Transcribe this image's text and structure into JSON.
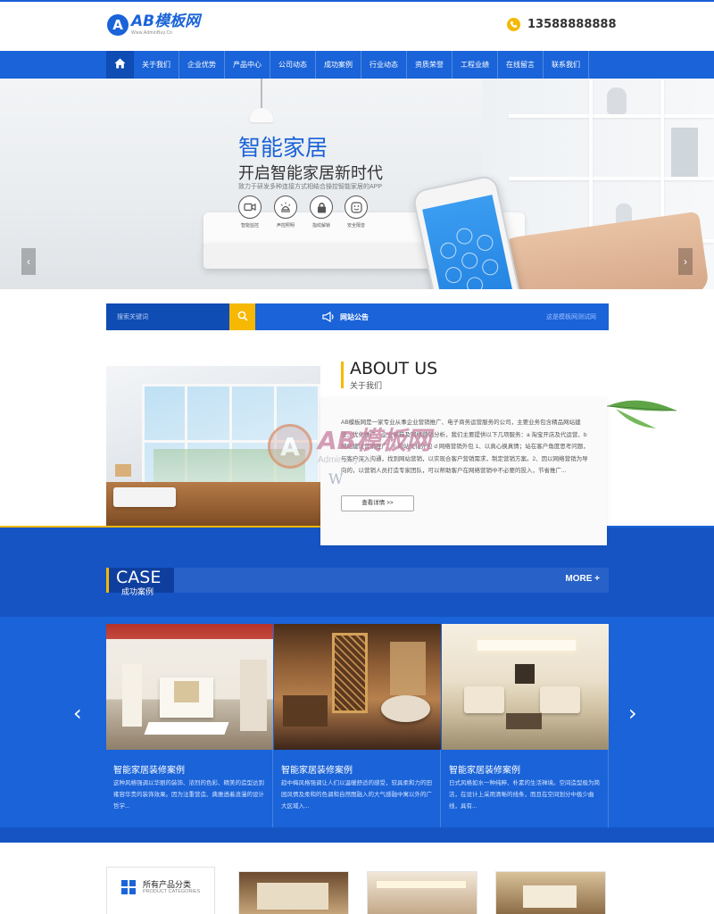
{
  "header": {
    "logo_mark": "A",
    "logo_title": "AB模板网",
    "logo_subtitle": "Www.AdminBuy.Cn",
    "phone_icon": "phone-icon",
    "phone": "13588888888"
  },
  "nav": {
    "home_icon": "home-icon",
    "items": [
      {
        "label": "关于我们"
      },
      {
        "label": "企业优势"
      },
      {
        "label": "产品中心"
      },
      {
        "label": "公司动态"
      },
      {
        "label": "成功案例"
      },
      {
        "label": "行业动态"
      },
      {
        "label": "资质荣誉"
      },
      {
        "label": "工程业绩"
      },
      {
        "label": "在线留言"
      },
      {
        "label": "联系我们"
      }
    ]
  },
  "banner": {
    "title": "智能家居",
    "subtitle": "开启智能家居新时代",
    "tagline": "致力于研发多种连接方式相结合操控智能家居的APP",
    "features": [
      {
        "label": "智能监控",
        "icon": "camera-icon"
      },
      {
        "label": "声控照明",
        "icon": "lamp-icon"
      },
      {
        "label": "指纹解锁",
        "icon": "lock-icon"
      },
      {
        "label": "安全隔音",
        "icon": "shield-icon"
      }
    ],
    "prev_icon": "chevron-left-icon",
    "next_icon": "chevron-right-icon"
  },
  "searchbar": {
    "placeholder": "搜索关键词",
    "search_icon": "search-icon",
    "notice_icon": "megaphone-icon",
    "notice_label": "网站公告",
    "notice_text": "这是模板网测试网"
  },
  "about": {
    "title": "ABOUT US",
    "subtitle": "关于我们",
    "text": "AB模板网是一家专业从事企业营销推广、电子商务运营服务的公司，主要业务包含精品网站建设、优化推广、企业邮箱及网络营销分析，我们主要提供以下几项服务：a 淘宝开店及代运营、b 网站建设营销推广、c 网站优化外包 d 网络营销外包 1、以真心换真情；站在客户角度思考问题，与客户深入沟通，找到网站营销，以实现合客户营销需求，制定营销方案。2、因以网络营销为导向的，以营销人员打造专家团队，可以帮助客户在网络营销中不必要的投入，节省推广...",
    "more": "查看详情 >>"
  },
  "watermark": {
    "mark": "A",
    "title": "AB模板网",
    "subtitle": "AdminBuy.Cn",
    "extra": "W"
  },
  "case": {
    "title": "CASE",
    "subtitle": "成功案例",
    "more": "MORE +",
    "prev_icon": "chevron-left-icon",
    "next_icon": "chevron-right-icon",
    "items": [
      {
        "name": "智能家居装修案例",
        "desc": "这种风格强调以华丽的装饰、浓烈的色彩、精美的造型达到雍容华贵的装饰效果。因为注重营造、典雅透着浪漫的设计哲学..."
      },
      {
        "name": "智能家居装修案例",
        "desc": "趋中梅风格强调让人们以温暖舒适的感受，较具柔和力的田园风情及柔和的色调和自然图融入的大气感融中寓以外的广大区域入..."
      },
      {
        "name": "智能家居装修案例",
        "desc": "日式风格如水一种纯粹、朴素的生活禅境。空间造型极为简洁，在设计上采用清晰的线条，而且在空间划分中极少曲线，具有..."
      }
    ]
  },
  "products": {
    "category_title": "所有产品分类",
    "category_subtitle": "PRODUCT CATEGORIES",
    "category_icon": "grid-icon"
  },
  "colors": {
    "primary": "#1a63d8",
    "primary_dark": "#0f4cb3",
    "accent": "#f6b800"
  }
}
